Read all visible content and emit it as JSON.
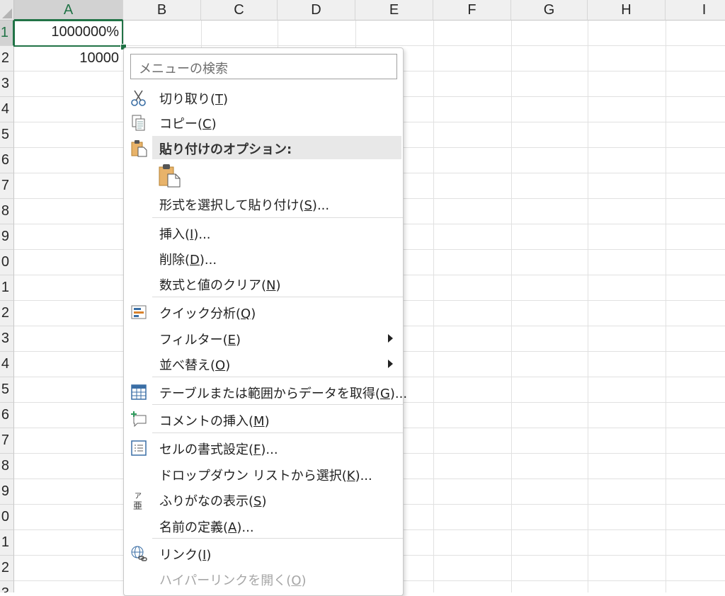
{
  "sheet": {
    "columns": [
      "A",
      "B",
      "C",
      "D",
      "E",
      "F",
      "G",
      "H",
      "I"
    ],
    "rows": [
      "1",
      "2",
      "3",
      "4",
      "5",
      "6",
      "7",
      "8",
      "9",
      "0",
      "1",
      "2",
      "3",
      "4",
      "5",
      "6",
      "7",
      "8",
      "9",
      "0",
      "1",
      "2",
      "3"
    ],
    "cells": {
      "A1": "1000000%",
      "A2": "10000"
    },
    "selected_column": "A",
    "selected_row": "1"
  },
  "context_menu": {
    "search_placeholder": "メニューの検索",
    "items": [
      {
        "pre": "切り取り(",
        "key": "T",
        "post": ")",
        "icon": "scissors-icon"
      },
      {
        "pre": "コピー(",
        "key": "C",
        "post": ")",
        "icon": "copy-icon"
      },
      {
        "pre": "貼り付けのオプション:",
        "key": "",
        "post": "",
        "icon": "clipboard-icon"
      },
      {
        "pre": "形式を選択して貼り付け(",
        "key": "S",
        "post": ")...",
        "icon": ""
      },
      {
        "pre": "挿入(",
        "key": "I",
        "post": ")...",
        "icon": ""
      },
      {
        "pre": "削除(",
        "key": "D",
        "post": ")...",
        "icon": ""
      },
      {
        "pre": "数式と値のクリア(",
        "key": "N",
        "post": ")",
        "icon": ""
      },
      {
        "pre": "クイック分析(",
        "key": "Q",
        "post": ")",
        "icon": "quick-analysis-icon"
      },
      {
        "pre": "フィルター(",
        "key": "E",
        "post": ")",
        "icon": "",
        "submenu": true
      },
      {
        "pre": "並べ替え(",
        "key": "O",
        "post": ")",
        "icon": "",
        "submenu": true
      },
      {
        "pre": "テーブルまたは範囲からデータを取得(",
        "key": "G",
        "post": ")...",
        "icon": "table-icon"
      },
      {
        "pre": "コメントの挿入(",
        "key": "M",
        "post": ")",
        "icon": "comment-icon"
      },
      {
        "pre": "セルの書式設定(",
        "key": "F",
        "post": ")...",
        "icon": "format-cells-icon"
      },
      {
        "pre": "ドロップダウン リストから選択(",
        "key": "K",
        "post": ")...",
        "icon": ""
      },
      {
        "pre": "ふりがなの表示(",
        "key": "S",
        "post": ")",
        "icon": "furigana-icon"
      },
      {
        "pre": "名前の定義(",
        "key": "A",
        "post": ")...",
        "icon": ""
      },
      {
        "pre": "リンク(",
        "key": "I",
        "post": ")",
        "icon": "link-icon"
      },
      {
        "pre": "ハイパーリンクを開く(",
        "key": "O",
        "post": ")",
        "icon": "",
        "disabled": true
      }
    ],
    "furigana_icon_top": "ア",
    "furigana_icon_bottom": "亜"
  }
}
